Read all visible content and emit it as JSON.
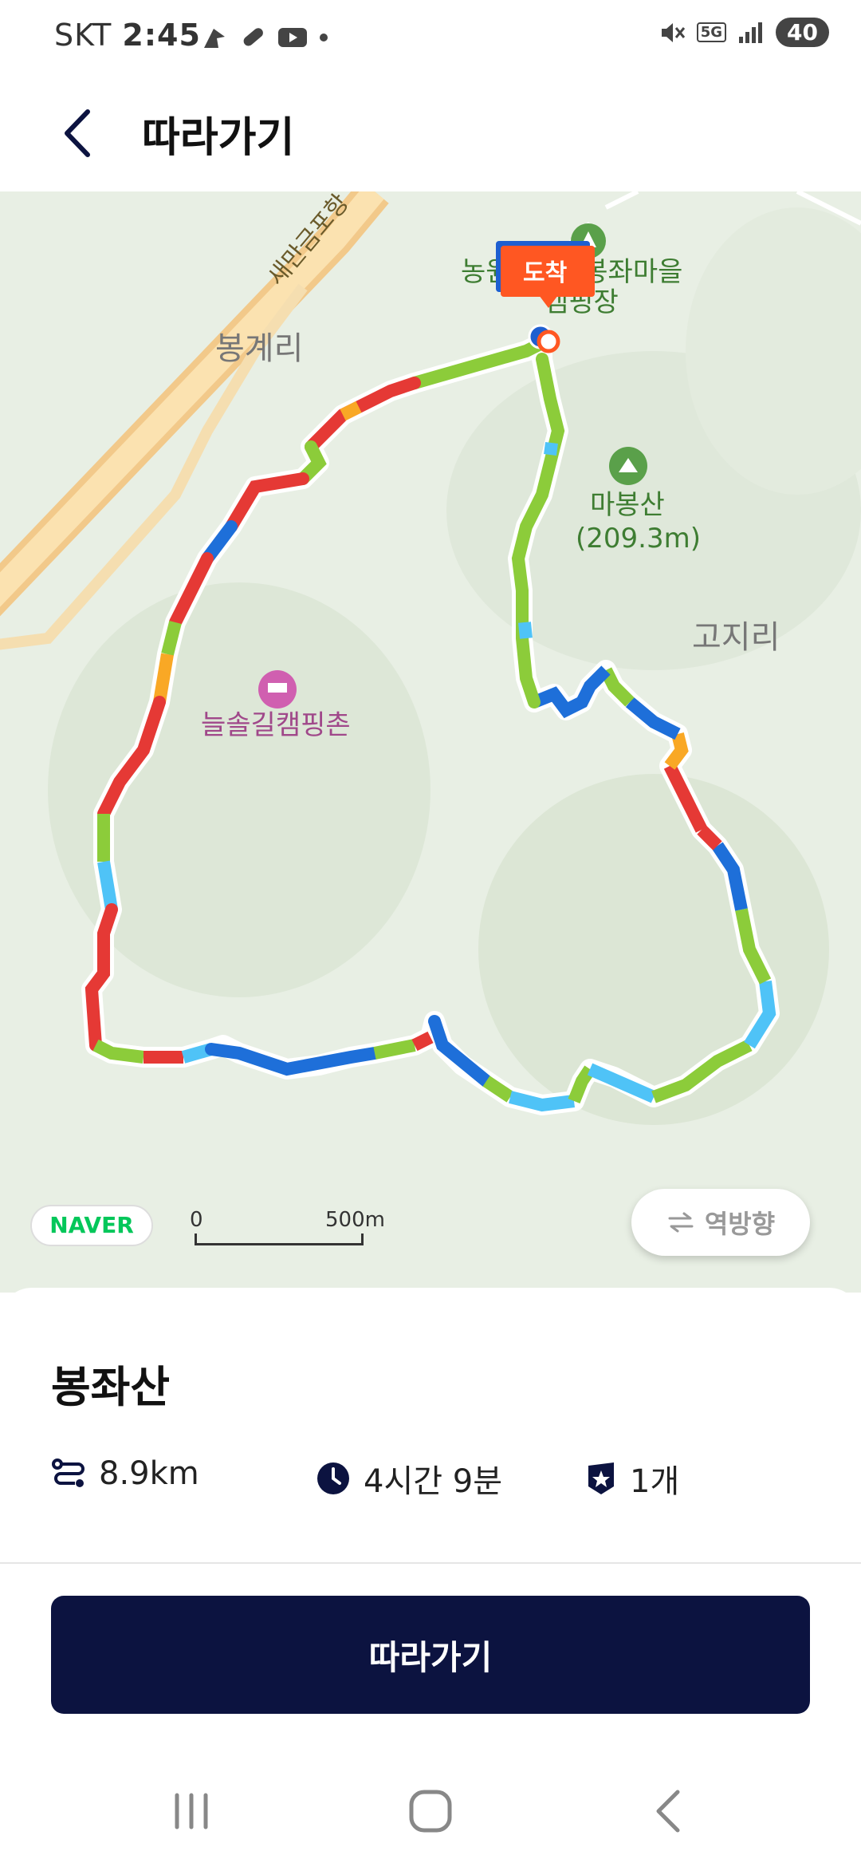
{
  "status_bar": {
    "carrier": "SKT",
    "time": "2:45",
    "battery": "40",
    "network": "5G"
  },
  "header": {
    "title": "따라가기"
  },
  "map": {
    "labels": {
      "road": "새만금포항",
      "village1": "봉계리",
      "camping_top_a": "농원",
      "camping_top_b": "인봉좌마을",
      "camping_top_c": "캠핑장",
      "mountain": "마봉산",
      "mountain_height": "(209.3m)",
      "village2": "고지리",
      "camp2": "늘솔길캠핑촌"
    },
    "arrival_marker": "도착",
    "provider": "NAVER",
    "scale_start": "0",
    "scale_end": "500m",
    "reverse_button": "역방향"
  },
  "course": {
    "name": "봉좌산",
    "distance": "8.9km",
    "duration": "4시간 9분",
    "count": "1개"
  },
  "follow_button": "따라가기",
  "colors": {
    "accent": "#0c1340",
    "marker": "#ff5722",
    "naver": "#03c75a"
  }
}
